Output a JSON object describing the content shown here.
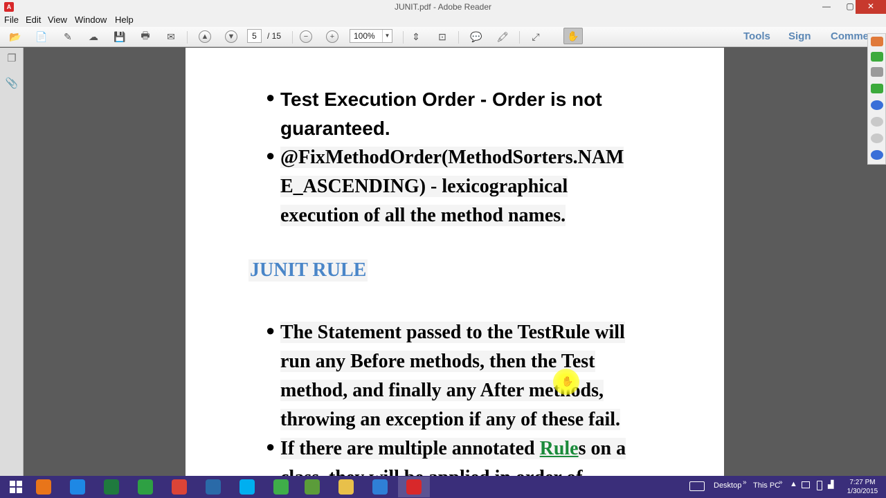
{
  "window": {
    "title": "JUNIT.pdf - Adobe Reader",
    "minimize_glyph": "—",
    "maximize_glyph": "▢",
    "close_glyph": "✕"
  },
  "menu": [
    "File",
    "Edit",
    "View",
    "Window",
    "Help"
  ],
  "toolbar": {
    "current_page": "5",
    "total_pages": "/ 15",
    "zoom": "100%",
    "tools_label": "Tools",
    "sign_label": "Sign",
    "comment_label": "Comme"
  },
  "document": {
    "item1_line1": "Test Execution Order - Order is not",
    "item1_line2": "guaranteed.",
    "item2_line1": "@FixMethodOrder(MethodSorters.NAM",
    "item2_line2": "E_ASCENDING)  - lexicographical",
    "item2_line3": "execution of all the method names.",
    "heading": "JUNIT RULE",
    "item3_line1": "The Statement passed to the TestRule will",
    "item3_line2": "run any Before methods, then the Test",
    "item3_line3": "method, and finally any After methods,",
    "item3_line4": "throwing an exception if any of these fail.",
    "item4_prefix": "If there are multiple annotated ",
    "item4_link": "Rule",
    "item4_suffix": "s on a",
    "item4_line2": "class, they will be applied in order of",
    "bullet": "●"
  },
  "taskbar": {
    "desktop_label": "Desktop",
    "this_pc_label": "This PC",
    "time": "7:27 PM",
    "date": "1/30/2015",
    "apps": [
      {
        "name": "firefox",
        "color": "#e8751a"
      },
      {
        "name": "internet-explorer",
        "color": "#1e88e5"
      },
      {
        "name": "excel",
        "color": "#1f7a3e"
      },
      {
        "name": "green-app",
        "color": "#2ea043"
      },
      {
        "name": "chrome",
        "color": "#db4437"
      },
      {
        "name": "vs-app",
        "color": "#2a6aa8"
      },
      {
        "name": "skype",
        "color": "#00aff0"
      },
      {
        "name": "green-app-2",
        "color": "#3fae49"
      },
      {
        "name": "image-app",
        "color": "#5b9c3a"
      },
      {
        "name": "file-explorer",
        "color": "#e8c04a"
      },
      {
        "name": "snowflake-app",
        "color": "#2f7fd6"
      },
      {
        "name": "adobe-reader",
        "color": "#d8282a"
      }
    ]
  },
  "colors": {
    "heading": "#4a86c8",
    "link": "#1a8a3a",
    "taskbar": "#3a2e7a",
    "close": "#c7392d"
  }
}
